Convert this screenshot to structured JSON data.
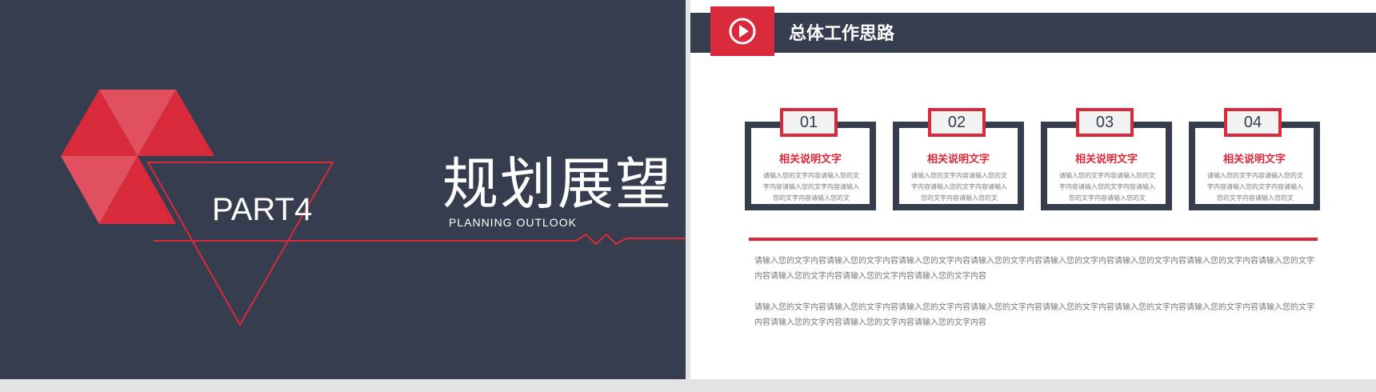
{
  "left_slide": {
    "part_label": "PART4",
    "main_title": "规划展望",
    "sub_title": "PLANNING  OUTLOOK",
    "colors": {
      "background": "#353d4e",
      "accent": "#d92a3c"
    }
  },
  "right_slide": {
    "header": {
      "icon": "play-icon",
      "title": "总体工作思路"
    },
    "cards": [
      {
        "number": "01",
        "title": "相关说明文字",
        "text": "请输入您的文字内容请输入您的文字内容请输入您的文字内容请输入您的文字内容请输入您的文"
      },
      {
        "number": "02",
        "title": "相关说明文字",
        "text": "请输入您的文字内容请输入您的文字内容请输入您的文字内容请输入您的文字内容请输入您的文"
      },
      {
        "number": "03",
        "title": "相关说明文字",
        "text": "请输入您的文字内容请输入您的文字内容请输入您的文字内容请输入您的文字内容请输入您的文"
      },
      {
        "number": "04",
        "title": "相关说明文字",
        "text": "请输入您的文字内容请输入您的文字内容请输入您的文字内容请输入您的文字内容请输入您的文"
      }
    ],
    "paragraphs": [
      "请输入您的文字内容请输入您的文字内容请输入您的文字内容请输入您的文字内容请输入您的文字内容请输入您的文字内容请输入您的文字内容请输入您的文字内容请输入您的文字内容请输入您的文字内容请输入您的文字内容",
      "请输入您的文字内容请输入您的文字内容请输入您的文字内容请输入您的文字内容请输入您的文字内容请输入您的文字内容请输入您的文字内容请输入您的文字内容请输入您的文字内容请输入您的文字内容请输入您的文字内容"
    ],
    "colors": {
      "header": "#353d4e",
      "accent": "#d92a3c"
    }
  }
}
